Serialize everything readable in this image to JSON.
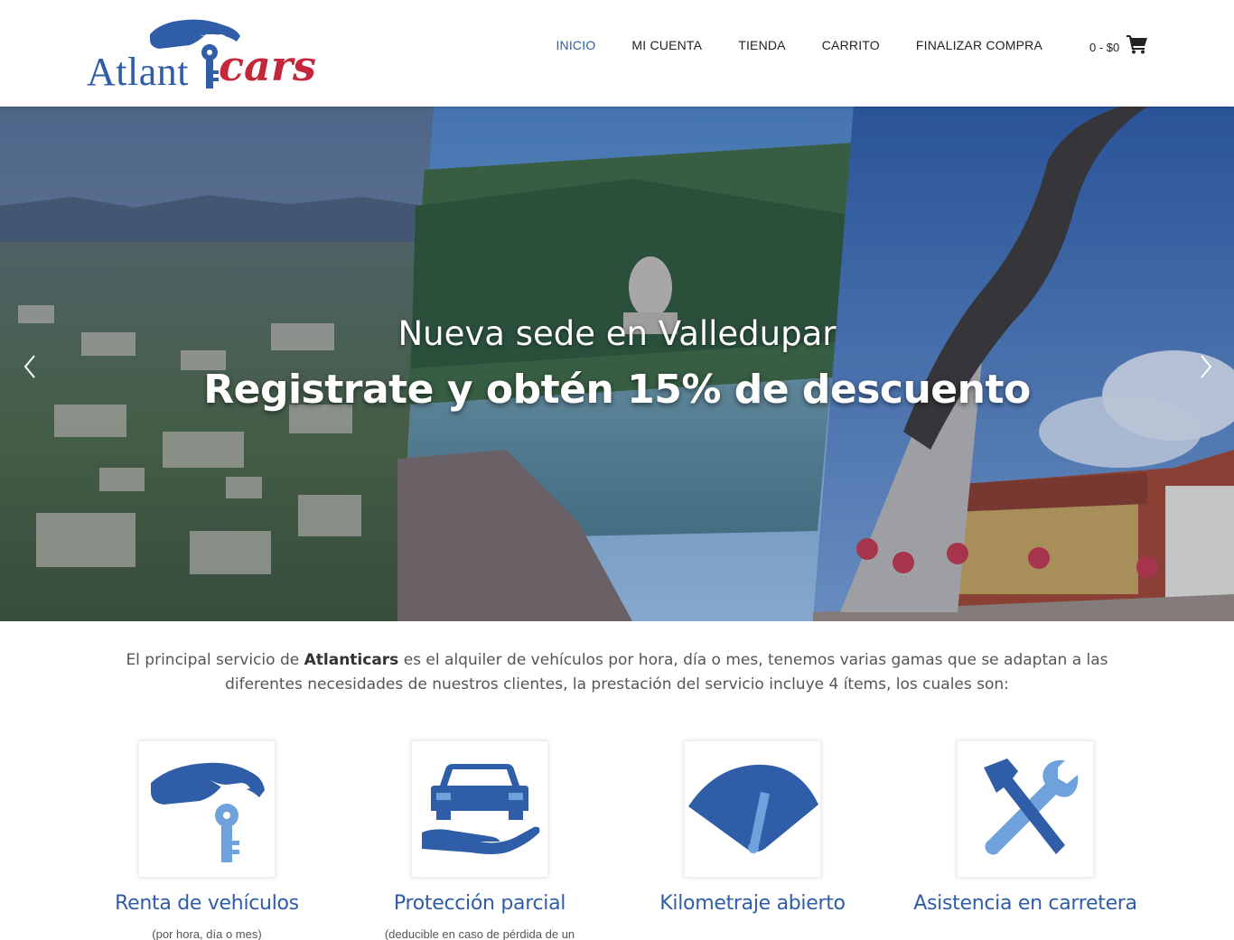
{
  "brand": {
    "name_part1": "Atlant",
    "name_part2": "cars",
    "colors": {
      "primary": "#2f5da8",
      "accent": "#c4263a"
    }
  },
  "nav": {
    "items": [
      {
        "label": "INICIO",
        "active": true
      },
      {
        "label": "MI CUENTA",
        "active": false
      },
      {
        "label": "TIENDA",
        "active": false
      },
      {
        "label": "CARRITO",
        "active": false
      },
      {
        "label": "FINALIZAR COMPRA",
        "active": false
      }
    ],
    "cart_total": "0 - $0",
    "cart_icon": "shopping-cart-icon"
  },
  "hero": {
    "subtitle": "Nueva sede en Valledupar",
    "title": "Registrate y obtén 15% de descuento",
    "prev_icon": "chevron-left-icon",
    "next_icon": "chevron-right-icon"
  },
  "intro": {
    "before": "El principal servicio de ",
    "bold": "Atlanticars",
    "after": " es el alquiler de vehículos por hora, día o mes, tenemos varias gamas que se adaptan a las diferentes necesidades de nuestros clientes, la prestación del servicio incluye 4 ítems, los cuales son:"
  },
  "features": [
    {
      "icon": "key-hand-icon",
      "title": "Renta de vehículos",
      "desc": "(por hora, día o mes)"
    },
    {
      "icon": "car-protection-icon",
      "title": "Protección parcial",
      "desc": "(deducible en caso de pérdida de un"
    },
    {
      "icon": "speedometer-icon",
      "title": "Kilometraje abierto",
      "desc": ""
    },
    {
      "icon": "tools-icon",
      "title": "Asistencia en carretera",
      "desc": ""
    }
  ]
}
